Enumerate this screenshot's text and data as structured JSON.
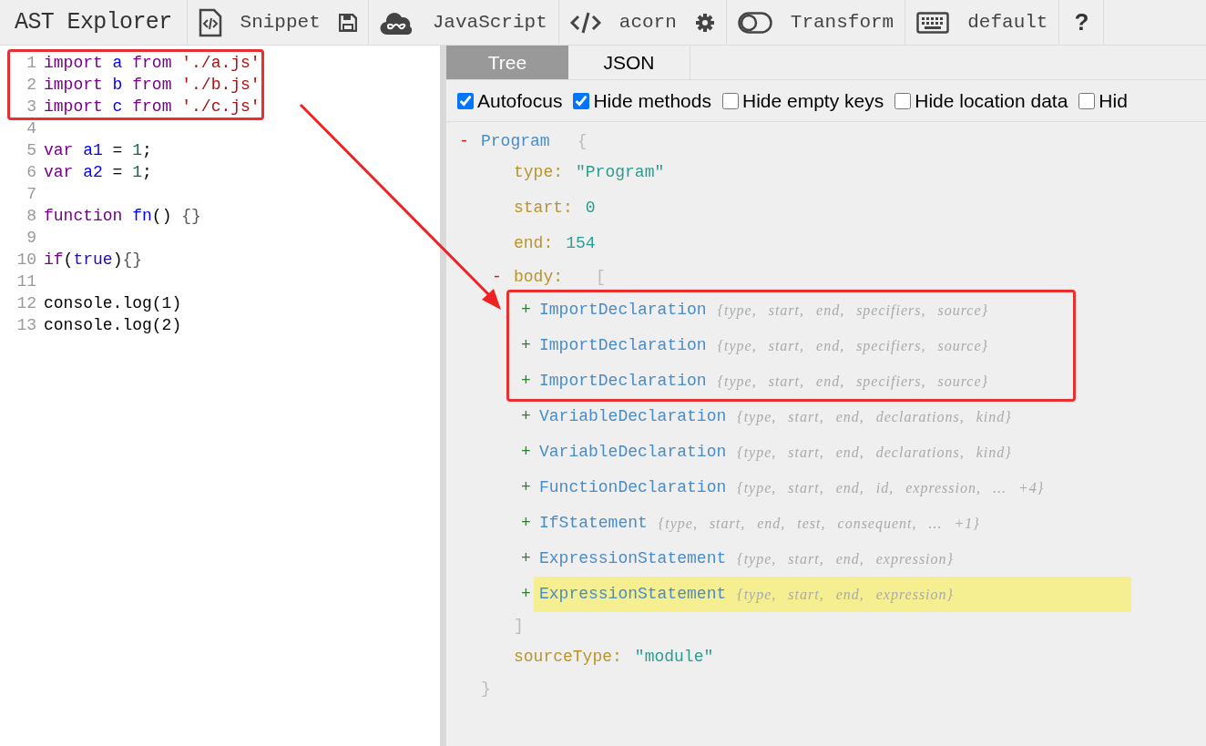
{
  "app_title": "AST Explorer",
  "toolbar": [
    {
      "label": "Snippet"
    },
    {
      "label": "JavaScript"
    },
    {
      "label": "acorn"
    },
    {
      "label": "Transform"
    },
    {
      "label": "default"
    },
    {
      "glyph": "?"
    }
  ],
  "editor": {
    "groups": [
      {
        "boxed": true,
        "lines": [
          {
            "number": "1",
            "tokens": [
              {
                "kind": "keyword",
                "text": "import"
              },
              {
                "kind": "def",
                "text": " a"
              },
              {
                "kind": "keyword",
                "text": " from"
              },
              {
                "kind": "string",
                "text": " './a.js'"
              }
            ]
          },
          {
            "number": "2",
            "tokens": [
              {
                "kind": "keyword",
                "text": "import"
              },
              {
                "kind": "def",
                "text": " b"
              },
              {
                "kind": "keyword",
                "text": " from"
              },
              {
                "kind": "string",
                "text": " './b.js'"
              }
            ]
          },
          {
            "number": "3",
            "tokens": [
              {
                "kind": "keyword",
                "text": "import"
              },
              {
                "kind": "def",
                "text": " c"
              },
              {
                "kind": "keyword",
                "text": " from"
              },
              {
                "kind": "string",
                "text": " './c.js'"
              }
            ]
          }
        ]
      },
      {
        "boxed": false,
        "lines": [
          {
            "number": "4"
          },
          {
            "number": "5",
            "tokens": [
              {
                "kind": "keyword",
                "text": "var"
              },
              {
                "kind": "def",
                "text": " a1"
              },
              {
                "kind": "plain",
                "text": " ="
              },
              {
                "kind": "number",
                "text": " 1"
              },
              {
                "kind": "plain",
                "text": ";"
              }
            ]
          },
          {
            "number": "6",
            "tokens": [
              {
                "kind": "keyword",
                "text": "var"
              },
              {
                "kind": "def",
                "text": " a2"
              },
              {
                "kind": "plain",
                "text": " ="
              },
              {
                "kind": "number",
                "text": " 1"
              },
              {
                "kind": "plain",
                "text": ";"
              }
            ]
          },
          {
            "number": "7"
          },
          {
            "number": "8",
            "tokens": [
              {
                "kind": "keyword",
                "text": "function"
              },
              {
                "kind": "def",
                "text": " fn"
              },
              {
                "kind": "plain",
                "text": "()"
              },
              {
                "kind": "bracket",
                "text": " {}"
              }
            ]
          },
          {
            "number": "9"
          },
          {
            "number": "10",
            "tokens": [
              {
                "kind": "keyword",
                "text": "if"
              },
              {
                "kind": "plain",
                "text": "("
              },
              {
                "kind": "atom",
                "text": "true"
              },
              {
                "kind": "plain",
                "text": ")"
              },
              {
                "kind": "bracket",
                "text": "{}"
              }
            ]
          },
          {
            "number": "11"
          },
          {
            "number": "12",
            "tokens": [
              {
                "kind": "plain",
                "text": "console.log(1)"
              }
            ]
          },
          {
            "number": "13",
            "tokens": [
              {
                "kind": "plain",
                "text": "console.log(2)"
              }
            ]
          }
        ]
      }
    ]
  },
  "tabs": [
    {
      "label": "Tree",
      "selected": true
    },
    {
      "label": "JSON",
      "selected": false
    }
  ],
  "options": [
    {
      "label": "Autofocus",
      "checked": true
    },
    {
      "label": "Hide methods",
      "checked": true
    },
    {
      "label": "Hide empty keys",
      "checked": false
    },
    {
      "label": "Hide location data",
      "checked": false
    },
    {
      "label": "Hid",
      "checked": false
    }
  ],
  "tree": {
    "toggle": "-",
    "label": "Program",
    "open": "{",
    "close": "}",
    "properties": [
      {
        "kind": "value",
        "key": "type:",
        "value": "\"Program\""
      },
      {
        "kind": "value",
        "key": "start:",
        "value": "0"
      },
      {
        "kind": "value",
        "key": "end:",
        "value": "154"
      },
      {
        "kind": "array",
        "toggle": "-",
        "key": "body:",
        "open": "[",
        "close": "]",
        "groups": [
          {
            "boxed": true,
            "children": [
              {
                "toggle": "+",
                "label": "ImportDeclaration",
                "summary": "{type, start, end, specifiers, source}",
                "highlighted": false
              },
              {
                "toggle": "+",
                "label": "ImportDeclaration",
                "summary": "{type, start, end, specifiers, source}",
                "highlighted": false
              },
              {
                "toggle": "+",
                "label": "ImportDeclaration",
                "summary": "{type, start, end, specifiers, source}",
                "highlighted": false
              }
            ]
          },
          {
            "boxed": false,
            "children": [
              {
                "toggle": "+",
                "label": "VariableDeclaration",
                "summary": "{type, start, end, declarations, kind}",
                "highlighted": false
              },
              {
                "toggle": "+",
                "label": "VariableDeclaration",
                "summary": "{type, start, end, declarations, kind}",
                "highlighted": false
              },
              {
                "toggle": "+",
                "label": "FunctionDeclaration",
                "summary": "{type, start, end, id, expression, ... +4}",
                "highlighted": false
              },
              {
                "toggle": "+",
                "label": "IfStatement",
                "summary": "{type, start, end, test, consequent, ... +1}",
                "highlighted": false
              },
              {
                "toggle": "+",
                "label": "ExpressionStatement",
                "summary": "{type, start, end, expression}",
                "highlighted": false
              },
              {
                "toggle": "+",
                "label": "ExpressionStatement",
                "summary": "{type, start, end, expression}",
                "highlighted": true
              }
            ]
          }
        ]
      },
      {
        "kind": "value",
        "key": "sourceType:",
        "value": "\"module\""
      }
    ]
  }
}
